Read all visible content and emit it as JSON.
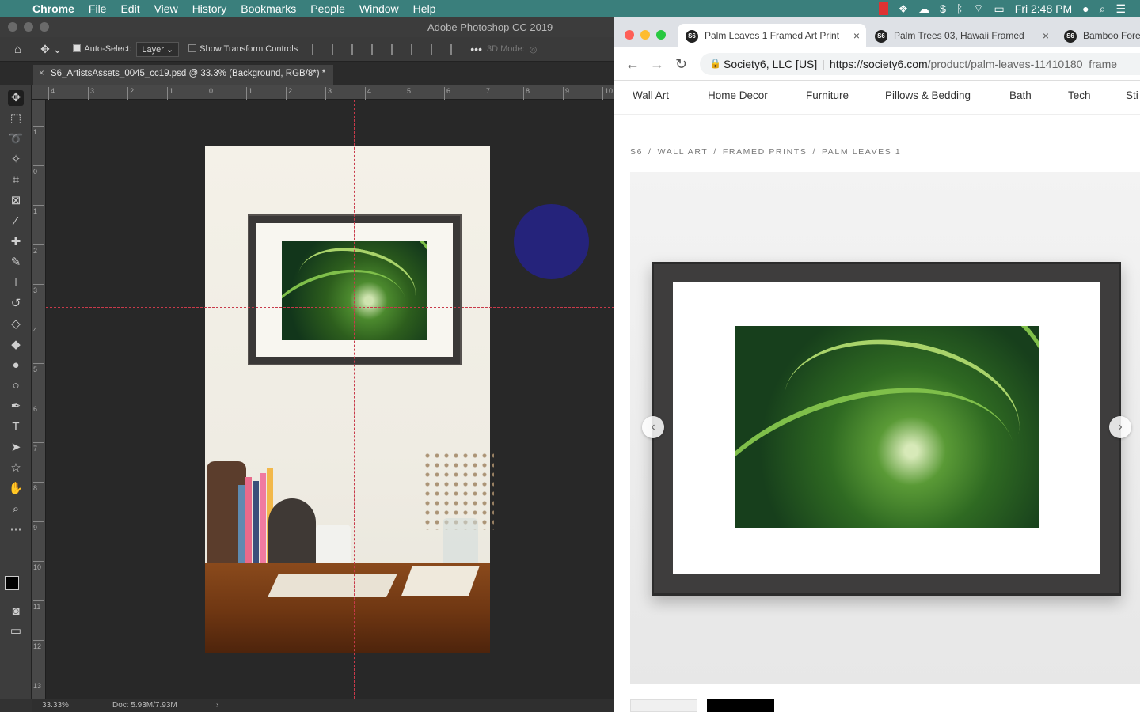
{
  "menubar": {
    "app": "Chrome",
    "items": [
      "File",
      "Edit",
      "View",
      "History",
      "Bookmarks",
      "People",
      "Window",
      "Help"
    ],
    "clock": "Fri 2:48 PM"
  },
  "photoshop": {
    "window_title": "Adobe Photoshop CC 2019",
    "options": {
      "auto_select_label": "Auto-Select:",
      "auto_select_value": "Layer",
      "transform_label": "Show Transform Controls",
      "mode_3d": "3D Mode:"
    },
    "document_tab": "S6_ArtistsAssets_0045_cc19.psd @ 33.3% (Background, RGB/8*) *",
    "ruler_top": [
      "4",
      "3",
      "2",
      "1",
      "0",
      "1",
      "2",
      "3",
      "4",
      "5",
      "6",
      "7",
      "8",
      "9",
      "10"
    ],
    "ruler_left": [
      "1",
      "0",
      "1",
      "2",
      "3",
      "4",
      "5",
      "6",
      "7",
      "8",
      "9",
      "10",
      "11",
      "12",
      "13"
    ],
    "status": {
      "zoom": "33.33%",
      "doc": "Doc: 5.93M/7.93M"
    },
    "colors": {
      "circle": "#25237b",
      "guide": "#c83a4a"
    }
  },
  "chrome": {
    "tabs": [
      {
        "title": "Palm Leaves 1 Framed Art Print",
        "favicon": "S6"
      },
      {
        "title": "Palm Trees 03, Hawaii Framed",
        "favicon": "S6"
      },
      {
        "title": "Bamboo Fore",
        "favicon": "S6"
      }
    ],
    "address": {
      "org": "Society6, LLC [US]",
      "url_host": "https://society6.com",
      "url_path": "/product/palm-leaves-11410180_frame"
    },
    "site_nav": [
      "Wall Art",
      "Home Decor",
      "Furniture",
      "Pillows & Bedding",
      "Bath",
      "Tech",
      "Sti"
    ],
    "breadcrumbs": [
      "S6",
      "WALL ART",
      "FRAMED PRINTS",
      "PALM LEAVES 1"
    ],
    "swatches": [
      "#f0f0f0",
      "#000000"
    ]
  }
}
